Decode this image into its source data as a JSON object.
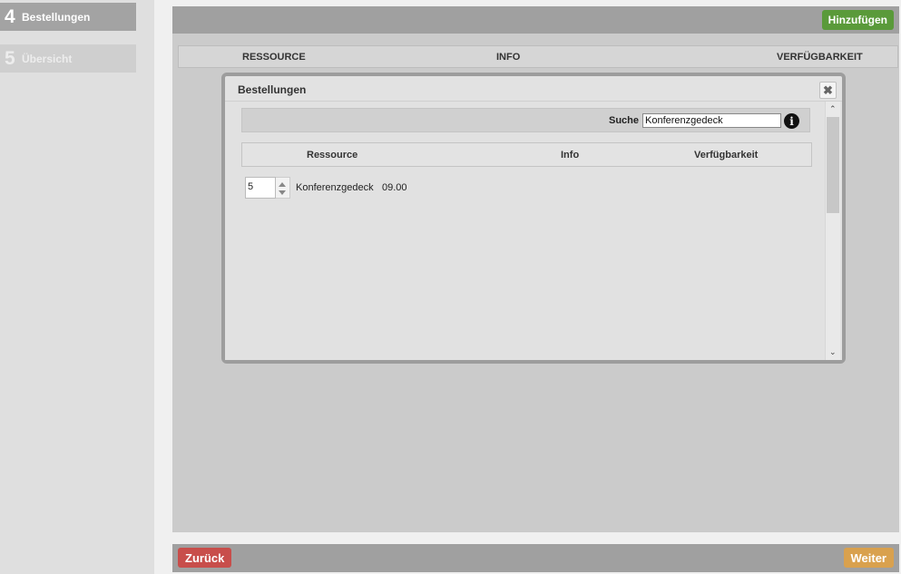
{
  "steps": [
    {
      "number": "4",
      "label": "Bestellungen",
      "active": true
    },
    {
      "number": "5",
      "label": "Übersicht",
      "active": false
    }
  ],
  "toolbar": {
    "add_label": "Hinzufügen"
  },
  "main_table": {
    "headers": [
      "RESSOURCE",
      "INFO",
      "VERFÜGBARKEIT"
    ]
  },
  "footer": {
    "back_label": "Zurück",
    "next_label": "Weiter"
  },
  "dialog": {
    "title": "Bestellungen",
    "close_icon": "close-icon",
    "search": {
      "label": "Suche",
      "value": "Konferenzgedeck"
    },
    "info_icon": "info-icon",
    "table": {
      "headers": [
        "Ressource",
        "Info",
        "Verfügbarkeit"
      ],
      "rows": [
        {
          "quantity": "5",
          "name": "Konferenzgedeck",
          "time": "09.00"
        }
      ]
    }
  },
  "colors": {
    "add": "#5a9a3a",
    "back": "#c84e4b",
    "next": "#d9a14e"
  }
}
